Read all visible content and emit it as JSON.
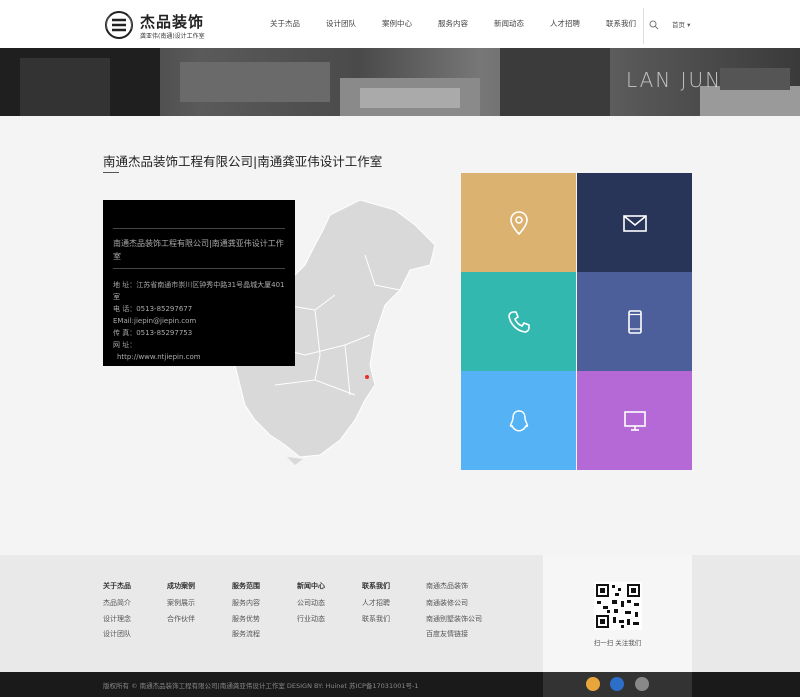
{
  "header": {
    "logo_title": "杰品装饰",
    "logo_subtitle": "龚亚伟(南通)设计工作室",
    "nav": [
      "关于杰品",
      "设计团队",
      "案例中心",
      "服务内容",
      "新闻动态",
      "人才招聘",
      "联系我们"
    ],
    "home_link": "首页 ▾"
  },
  "banner": {
    "text": "LAN JUN"
  },
  "main": {
    "heading": "南通杰品装饰工程有限公司|南通龚亚伟设计工作室",
    "info": {
      "company": "南通杰品装饰工程有限公司|南通龚亚伟设计工作室",
      "address": "地 址：江苏省南通市崇川区钟秀中路31号晶城大厦401室",
      "phone": "电 话：0513-85297677",
      "email": "EMail:jiepin@jiepin.com",
      "fax": "传 真：0513-85297753",
      "url_label": "网 址：",
      "url": "http://www.ntjiepin.com"
    },
    "tiles": [
      {
        "icon": "location-pin-icon",
        "color": "#dbb26f"
      },
      {
        "icon": "mail-icon",
        "color": "#283559"
      },
      {
        "icon": "phone-icon",
        "color": "#33b8b0"
      },
      {
        "icon": "mobile-icon",
        "color": "#4d5f9a"
      },
      {
        "icon": "qq-icon",
        "color": "#54b2f5"
      },
      {
        "icon": "monitor-icon",
        "color": "#b569d6"
      }
    ]
  },
  "footer": {
    "columns": [
      {
        "title": "关于杰品",
        "links": [
          "杰品简介",
          "设计理念",
          "设计团队"
        ]
      },
      {
        "title": "成功案例",
        "links": [
          "案例展示",
          "合作伙伴"
        ]
      },
      {
        "title": "服务范围",
        "links": [
          "服务内容",
          "服务优势",
          "服务流程"
        ]
      },
      {
        "title": "新闻中心",
        "links": [
          "公司动态",
          "行业动态"
        ]
      },
      {
        "title": "联系我们",
        "links": [
          "人才招聘",
          "联系我们"
        ]
      },
      {
        "title": "南通杰品装饰",
        "links": [
          "南通装修公司",
          "南通别墅装饰公司",
          "百度友情链接"
        ]
      }
    ],
    "qr_caption": "扫一扫 关注我们",
    "copyright": "版权所有 © 南通杰品装饰工程有限公司|南通龚亚伟设计工作室 DESIGN BY: Huinet 苏ICP备17031001号-1",
    "social": [
      {
        "icon": "qq-social-icon",
        "color": "#e8a53c"
      },
      {
        "icon": "weibo-social-icon",
        "color": "#2d6ec9"
      },
      {
        "icon": "wechat-social-icon",
        "color": "#888888"
      }
    ]
  }
}
